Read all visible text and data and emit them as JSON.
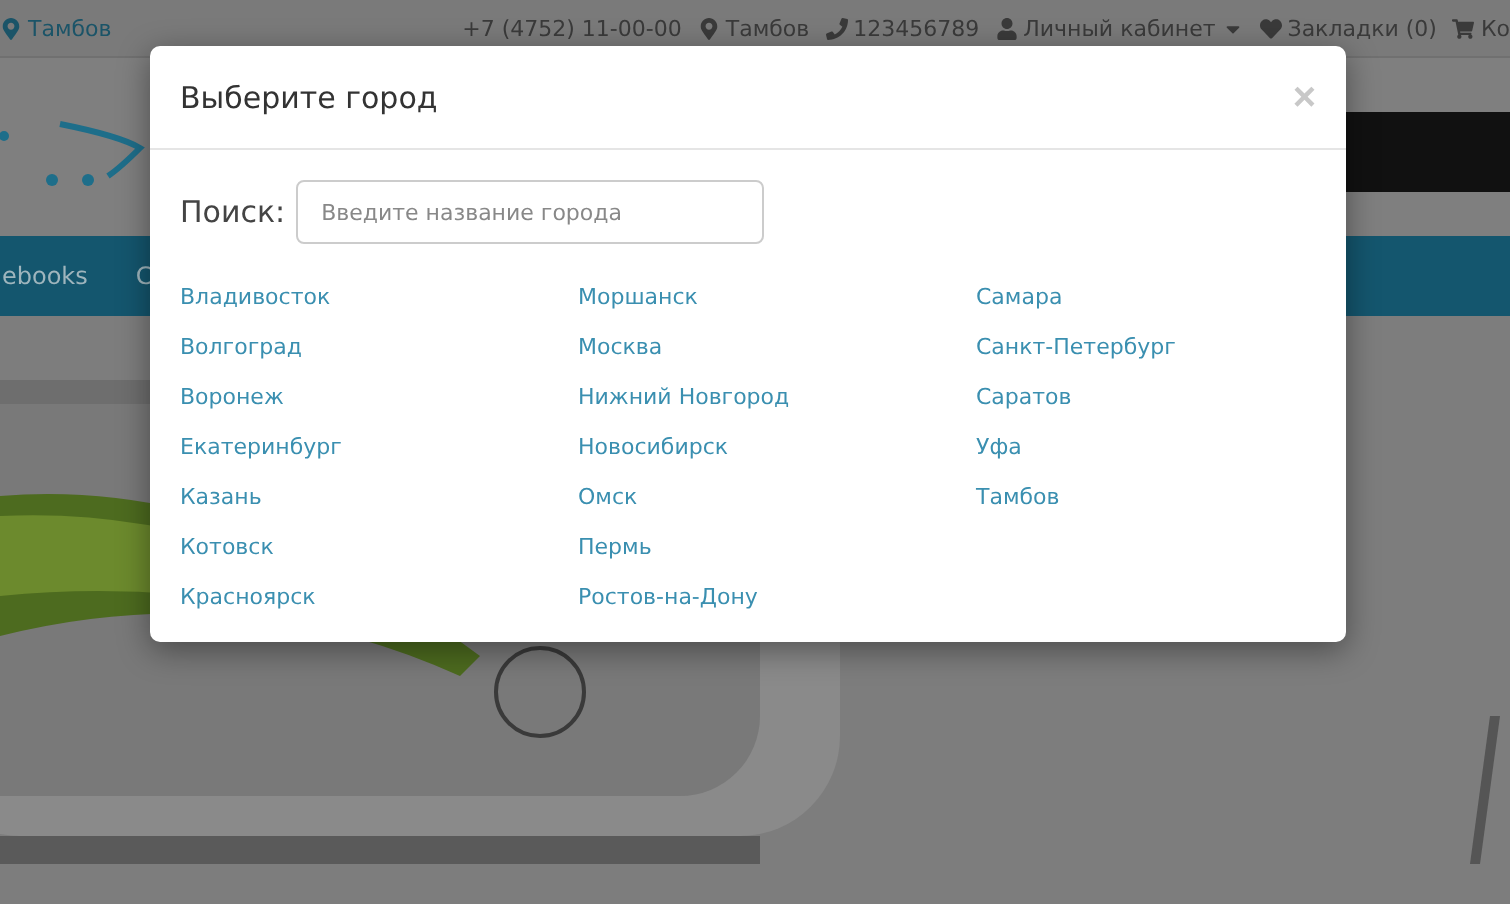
{
  "top_bar": {
    "city": "Тамбов",
    "phone_main": "+7 (4752) 11-00-00",
    "city_2": "Тамбов",
    "phone": "123456789",
    "account": "Личный кабинет",
    "bookmarks": "Закладки (0)",
    "cart": "Ко"
  },
  "nav": {
    "items": [
      "ebooks",
      "C"
    ]
  },
  "modal": {
    "title": "Выберите город",
    "close": "×",
    "search_label": "Поиск:",
    "search": {
      "placeholder": "Введите название города"
    },
    "columns": [
      [
        "Владивосток",
        "Волгоград",
        "Воронеж",
        "Екатеринбург",
        "Казань",
        "Котовск",
        "Красноярск"
      ],
      [
        "Моршанск",
        "Москва",
        "Нижний Новгород",
        "Новосибирск",
        "Омск",
        "Пермь",
        "Ростов-на-Дону"
      ],
      [
        "Самара",
        "Санкт-Петербург",
        "Саратов",
        "Уфа",
        "Тамбов"
      ]
    ]
  }
}
